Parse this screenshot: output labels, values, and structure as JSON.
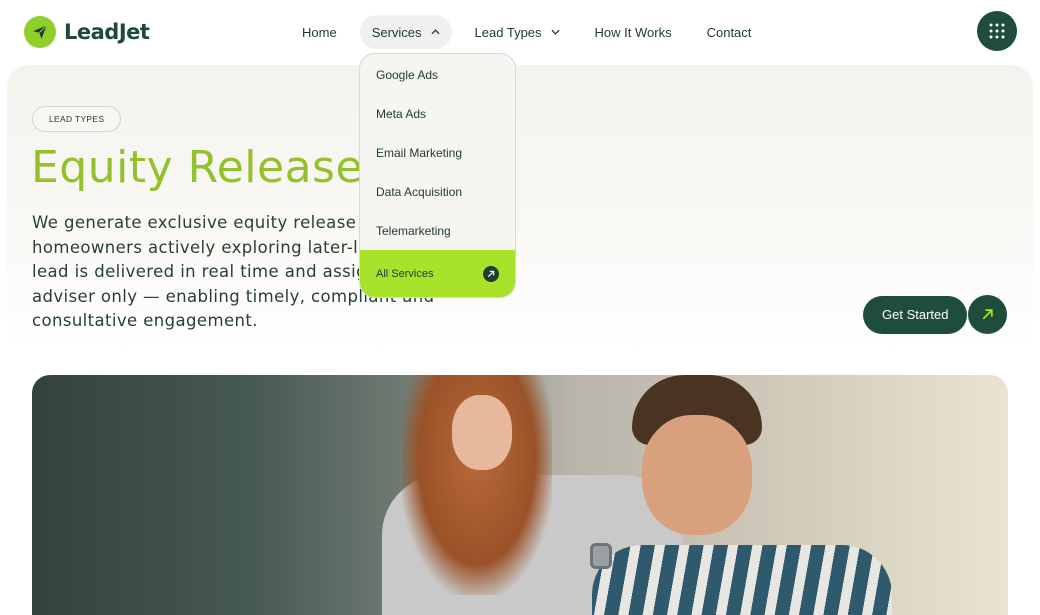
{
  "brand": {
    "name": "LeadJet"
  },
  "nav": {
    "items": [
      {
        "label": "Home"
      },
      {
        "label": "Services"
      },
      {
        "label": "Lead Types"
      },
      {
        "label": "How It Works"
      },
      {
        "label": "Contact"
      }
    ]
  },
  "services_menu": {
    "items": [
      {
        "label": "Google Ads"
      },
      {
        "label": "Meta Ads"
      },
      {
        "label": "Email Marketing"
      },
      {
        "label": "Data Acquisition"
      },
      {
        "label": "Telemarketing"
      }
    ],
    "all_label": "All Services"
  },
  "hero": {
    "badge": "LEAD TYPES",
    "title": "Equity Release L",
    "body": "We generate exclusive equity release enquiries from homeowners actively exploring later-life lending. Every lead is delivered in real time and assigned to one adviser only — enabling timely, compliant and consultative engagement.",
    "cta_label": "Get Started"
  },
  "icons": {
    "logo": "paper-plane-icon",
    "menu": "grid-dots-icon",
    "cta": "arrow-up-right-icon"
  },
  "colors": {
    "brand_dark": "#1e4d3b",
    "accent_green": "#a8e22a",
    "title_green": "#94c12a"
  }
}
